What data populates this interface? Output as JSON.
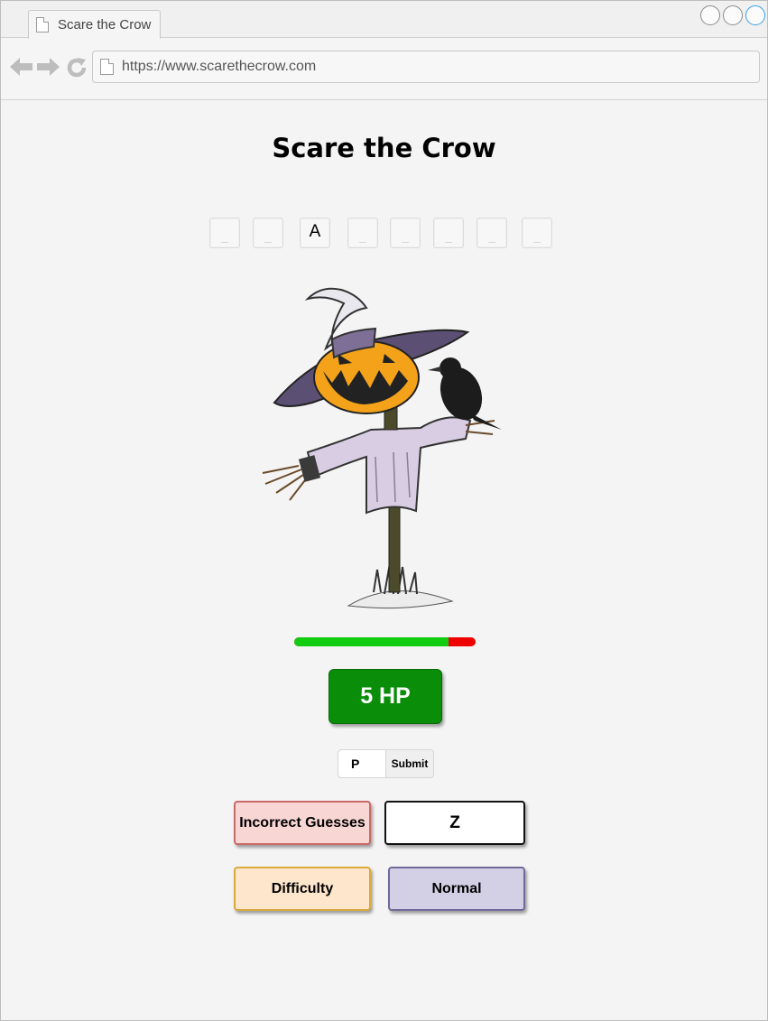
{
  "browser": {
    "tab_title": "Scare the Crow",
    "url": "https://www.scarethecrow.com"
  },
  "game": {
    "title": "Scare the Crow",
    "letters": [
      "_",
      "_",
      "A",
      "_",
      "_",
      "_",
      "_",
      "_"
    ],
    "health_fraction": 0.85,
    "hp_label": "5 HP",
    "guess_input_value": "P",
    "submit_label": "Submit",
    "incorrect_label": "Incorrect Guesses",
    "incorrect_value": "Z",
    "difficulty_label": "Difficulty",
    "difficulty_value": "Normal"
  },
  "colors": {
    "health_green": "#11cc11",
    "health_red": "#ee0000",
    "hp_badge": "#0a8e0a",
    "incorrect_bg": "#f8d6d4",
    "difficulty_bg": "#fde6cc",
    "difficulty_value_bg": "#d3d0e6"
  },
  "icons": {
    "back": "arrow-left-icon",
    "forward": "arrow-right-icon",
    "reload": "reload-icon",
    "page": "document-icon"
  }
}
